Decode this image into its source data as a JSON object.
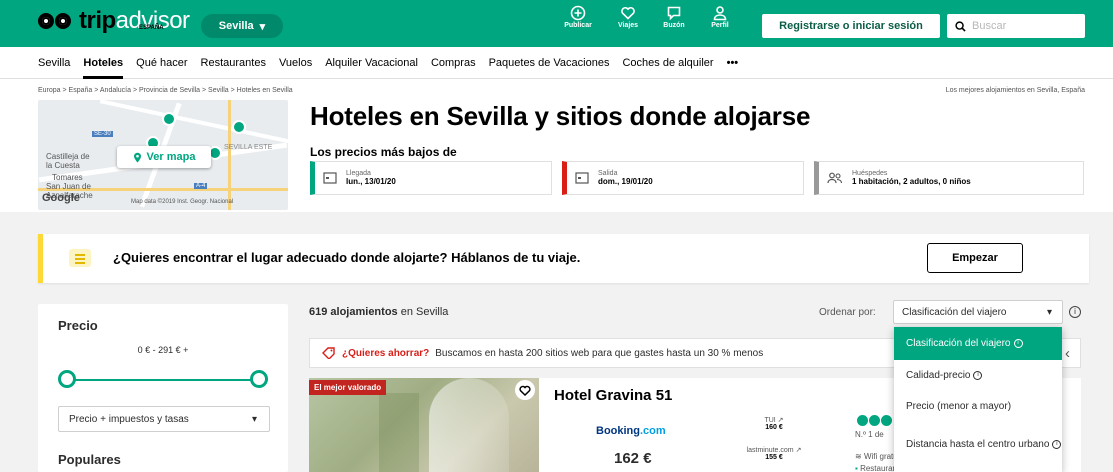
{
  "header": {
    "logo_part1": "trip",
    "logo_part2": "advisor",
    "logo_country": "ESPAÑA",
    "city": "Sevilla",
    "icons": [
      {
        "label": "Publicar",
        "icon": "plus-circle-icon"
      },
      {
        "label": "Viajes",
        "icon": "heart-icon"
      },
      {
        "label": "Buzón",
        "icon": "chat-icon"
      },
      {
        "label": "Perfil",
        "icon": "user-icon"
      }
    ],
    "login": "Registrarse o iniciar sesión",
    "search_placeholder": "Buscar",
    "brand_color": "#00a680"
  },
  "nav": {
    "items": [
      "Sevilla",
      "Hoteles",
      "Qué hacer",
      "Restaurantes",
      "Vuelos",
      "Alquiler Vacacional",
      "Compras",
      "Paquetes de Vacaciones",
      "Coches de alquiler",
      "•••"
    ],
    "active": "Hoteles"
  },
  "breadcrumb": "Europa > España > Andalucía > Provincia de Sevilla > Sevilla > Hoteles en Sevilla",
  "best_link": "Los mejores alojamientos en Sevilla, España",
  "map": {
    "button": "Ver mapa",
    "labels": [
      "Castilleja de la Cuesta",
      "Tomares",
      "San Juan de Aznalfarache",
      "SE-30",
      "A-4",
      "SEVILLA ESTE"
    ],
    "google": "Google",
    "attribution": "Map data ©2019 Inst. Geogr. Nacional"
  },
  "page": {
    "title": "Hoteles en Sevilla y sitios donde alojarse",
    "lowest_prices": "Los precios más bajos de",
    "checkin_label": "Llegada",
    "checkin_value": "lun., 13/01/20",
    "checkout_label": "Salida",
    "checkout_value": "dom., 19/01/20",
    "guests_label": "Huéspedes",
    "guests_value": "1 habitación, 2 adultos, 0 niños"
  },
  "promo": {
    "text": "¿Quieres encontrar el lugar adecuado donde alojarte? Háblanos de tu viaje.",
    "button": "Empezar"
  },
  "filters": {
    "price_title": "Precio",
    "price_range": "0 € - 291 € +",
    "price_select": "Precio + impuestos y tasas",
    "popular_title": "Populares"
  },
  "results": {
    "count": "619 alojamientos",
    "count_suffix": "en Sevilla",
    "order_label": "Ordenar por:",
    "order_value": "Clasificación del viajero",
    "save_highlight": "¿Quieres ahorrar?",
    "save_text": "Buscamos en hasta 200 sitios web para que gastes hasta un 30 % menos",
    "dropdown": [
      "Clasificación del viajero",
      "Calidad-precio",
      "Precio (menor a mayor)",
      "Distancia hasta el centro urbano"
    ]
  },
  "hotel": {
    "badge": "El mejor valorado",
    "name": "Hotel Gravina 51",
    "provider_a": "Booking",
    "provider_b": ".com",
    "price": "162 €",
    "offers": [
      {
        "site": "TUI ↗",
        "price": "160 €"
      },
      {
        "site": "lastminute.com ↗",
        "price": "155 €"
      }
    ],
    "rank": "N.º 1 de",
    "amenity1": "Wifi gratuito",
    "amenity2": "Restaurante"
  }
}
